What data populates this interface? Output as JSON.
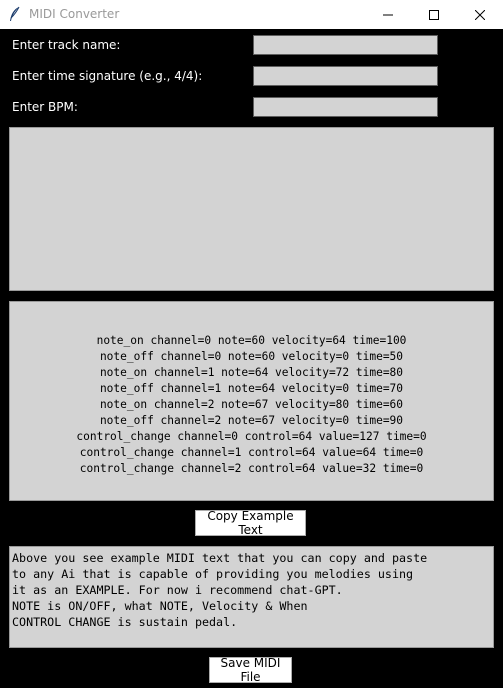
{
  "window": {
    "title": "MIDI Converter",
    "icon": "feather-icon",
    "controls": [
      "minimize-icon",
      "maximize-icon",
      "close-icon"
    ]
  },
  "form": {
    "track_name_label": "Enter track name:",
    "track_name_value": "",
    "time_signature_label": "Enter time signature (e.g., 4/4):",
    "time_signature_value": "",
    "bpm_label": "Enter BPM:",
    "bpm_value": ""
  },
  "melody_input": {
    "value": ""
  },
  "example": {
    "lines": [
      "note_on channel=0 note=60 velocity=64 time=100",
      "note_off channel=0 note=60 velocity=0 time=50",
      "note_on channel=1 note=64 velocity=72 time=80",
      "note_off channel=1 note=64 velocity=0 time=70",
      "note_on channel=2 note=67 velocity=80 time=60",
      "note_off channel=2 note=67 velocity=0 time=90",
      "control_change channel=0 control=64 value=127 time=0",
      "control_change channel=1 control=64 value=64 time=0",
      "control_change channel=2 control=64 value=32 time=0"
    ],
    "copy_button_label": "Copy Example Text"
  },
  "info": {
    "lines": [
      "Above you see example MIDI text that you can copy and paste",
      "to any Ai that is capable of providing you melodies using",
      "it as an EXAMPLE. For now i recommend chat-GPT.",
      "NOTE is ON/OFF, what NOTE, Velocity & When",
      "CONTROL CHANGE is sustain pedal."
    ]
  },
  "save_button_label": "Save MIDI File",
  "colors": {
    "background": "#000000",
    "field": "#d3d3d3",
    "button": "#ffffff",
    "label_text": "#ffffff",
    "title_text": "#999999"
  }
}
